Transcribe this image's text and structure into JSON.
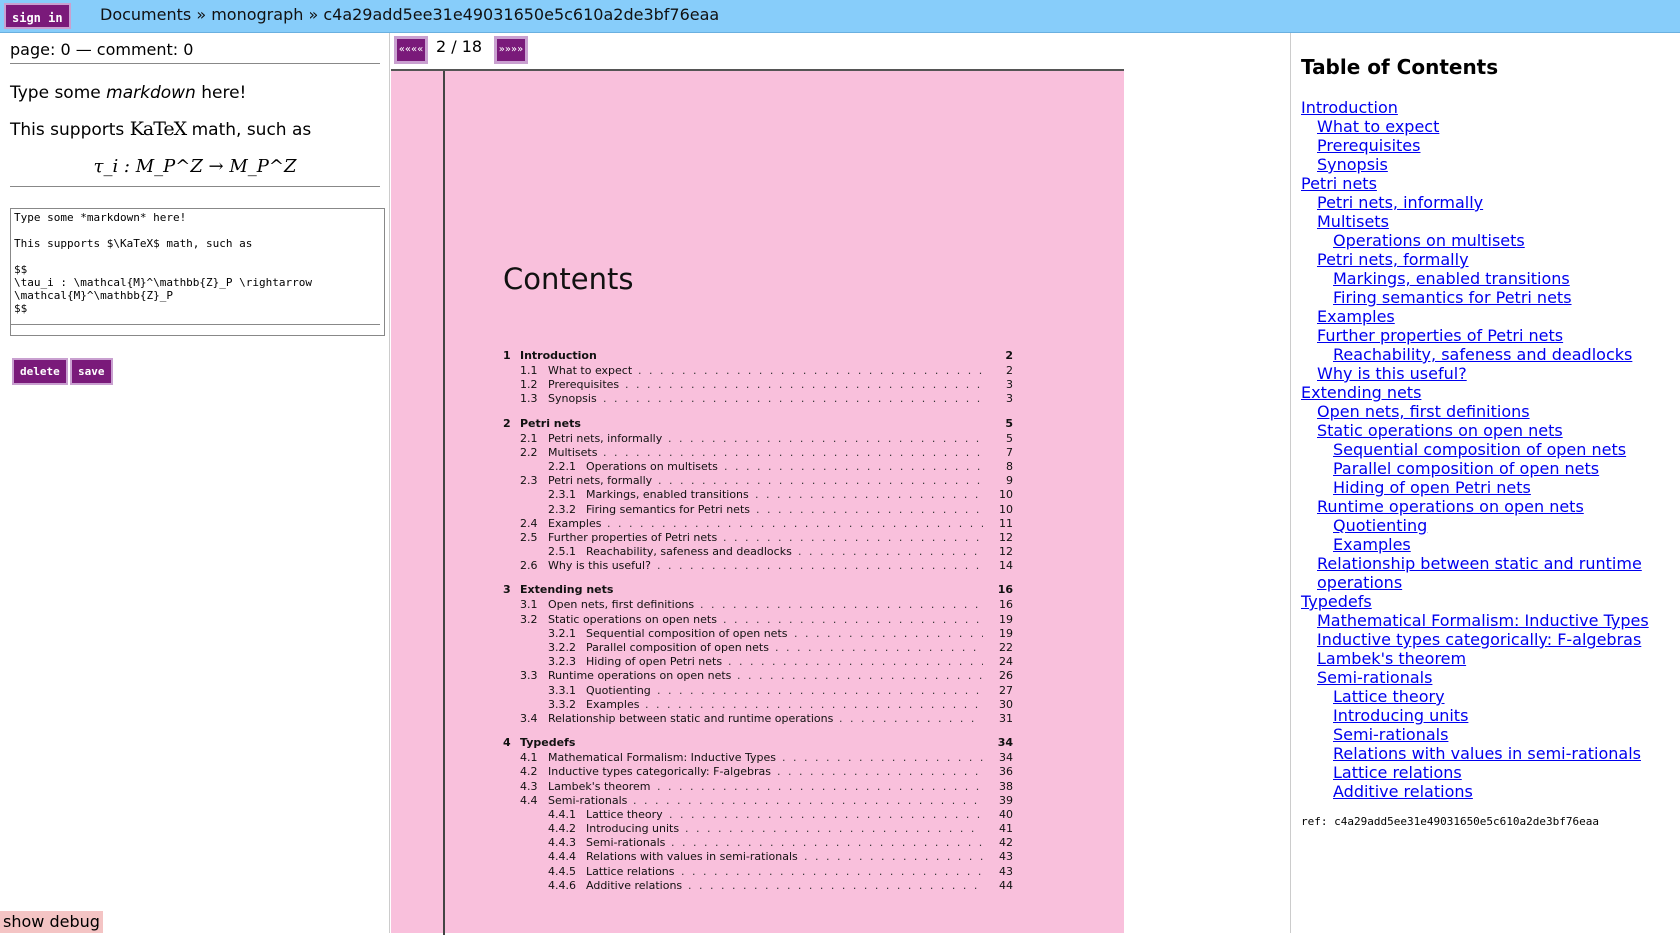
{
  "topbar": {
    "sign_in": "sign in",
    "breadcrumb": [
      "Documents",
      "»",
      "monograph",
      "»",
      "c4a29add5ee31e49031650e5c610a2de3bf76eaa"
    ]
  },
  "left": {
    "status": "page: 0 — comment: 0",
    "preview_line1_a": "Type some ",
    "preview_line1_em": "markdown",
    "preview_line1_b": " here!",
    "preview_line2_a": "This supports ",
    "katex": "KaTeX",
    "preview_line2_b": " math, such as",
    "formula": "τ_i : M_P^Z → M_P^Z",
    "editor_text": "Type some *markdown* here!\n\nThis supports $\\KaTeX$ math, such as\n\n$$\n\\tau_i : \\mathcal{M}^\\mathbb{Z}_P \\rightarrow\n\\mathcal{M}^\\mathbb{Z}_P\n$$",
    "delete_label": "delete",
    "save_label": "save",
    "debug_label": "show debug"
  },
  "viewer": {
    "prev_icon": "««««",
    "next_icon": "»»»»",
    "page_indicator": "2 / 18",
    "heading": "Contents",
    "entries": [
      {
        "n": "1",
        "t": "Introduction",
        "p": "2",
        "lvl": 0
      },
      {
        "n": "1.1",
        "t": "What to expect",
        "p": "2",
        "lvl": 1
      },
      {
        "n": "1.2",
        "t": "Prerequisites",
        "p": "3",
        "lvl": 1
      },
      {
        "n": "1.3",
        "t": "Synopsis",
        "p": "3",
        "lvl": 1
      },
      {
        "n": "2",
        "t": "Petri nets",
        "p": "5",
        "lvl": 0
      },
      {
        "n": "2.1",
        "t": "Petri nets, informally",
        "p": "5",
        "lvl": 1
      },
      {
        "n": "2.2",
        "t": "Multisets",
        "p": "7",
        "lvl": 1
      },
      {
        "n": "2.2.1",
        "t": "Operations on multisets",
        "p": "8",
        "lvl": 2
      },
      {
        "n": "2.3",
        "t": "Petri nets, formally",
        "p": "9",
        "lvl": 1
      },
      {
        "n": "2.3.1",
        "t": "Markings, enabled transitions",
        "p": "10",
        "lvl": 2
      },
      {
        "n": "2.3.2",
        "t": "Firing semantics for Petri nets",
        "p": "10",
        "lvl": 2
      },
      {
        "n": "2.4",
        "t": "Examples",
        "p": "11",
        "lvl": 1
      },
      {
        "n": "2.5",
        "t": "Further properties of Petri nets",
        "p": "12",
        "lvl": 1
      },
      {
        "n": "2.5.1",
        "t": "Reachability, safeness and deadlocks",
        "p": "12",
        "lvl": 2
      },
      {
        "n": "2.6",
        "t": "Why is this useful?",
        "p": "14",
        "lvl": 1
      },
      {
        "n": "3",
        "t": "Extending nets",
        "p": "16",
        "lvl": 0
      },
      {
        "n": "3.1",
        "t": "Open nets, first definitions",
        "p": "16",
        "lvl": 1
      },
      {
        "n": "3.2",
        "t": "Static operations on open nets",
        "p": "19",
        "lvl": 1
      },
      {
        "n": "3.2.1",
        "t": "Sequential composition of open nets",
        "p": "19",
        "lvl": 2
      },
      {
        "n": "3.2.2",
        "t": "Parallel composition of open nets",
        "p": "22",
        "lvl": 2
      },
      {
        "n": "3.2.3",
        "t": "Hiding of open Petri nets",
        "p": "24",
        "lvl": 2
      },
      {
        "n": "3.3",
        "t": "Runtime operations on open nets",
        "p": "26",
        "lvl": 1
      },
      {
        "n": "3.3.1",
        "t": "Quotienting",
        "p": "27",
        "lvl": 2
      },
      {
        "n": "3.3.2",
        "t": "Examples",
        "p": "30",
        "lvl": 2
      },
      {
        "n": "3.4",
        "t": "Relationship between static and runtime operations",
        "p": "31",
        "lvl": 1
      },
      {
        "n": "4",
        "t": "Typedefs",
        "p": "34",
        "lvl": 0
      },
      {
        "n": "4.1",
        "t": "Mathematical Formalism: Inductive Types",
        "p": "34",
        "lvl": 1
      },
      {
        "n": "4.2",
        "t": "Inductive types categorically: F-algebras",
        "p": "36",
        "lvl": 1
      },
      {
        "n": "4.3",
        "t": "Lambek's theorem",
        "p": "38",
        "lvl": 1
      },
      {
        "n": "4.4",
        "t": "Semi-rationals",
        "p": "39",
        "lvl": 1
      },
      {
        "n": "4.4.1",
        "t": "Lattice theory",
        "p": "40",
        "lvl": 2
      },
      {
        "n": "4.4.2",
        "t": "Introducing units",
        "p": "41",
        "lvl": 2
      },
      {
        "n": "4.4.3",
        "t": "Semi-rationals",
        "p": "42",
        "lvl": 2
      },
      {
        "n": "4.4.4",
        "t": "Relations with values in semi-rationals",
        "p": "43",
        "lvl": 2
      },
      {
        "n": "4.4.5",
        "t": "Lattice relations",
        "p": "43",
        "lvl": 2
      },
      {
        "n": "4.4.6",
        "t": "Additive relations",
        "p": "44",
        "lvl": 2
      }
    ]
  },
  "right": {
    "title": "Table of Contents",
    "links": [
      {
        "t": "Introduction",
        "lvl": 1
      },
      {
        "t": "What to expect",
        "lvl": 2
      },
      {
        "t": "Prerequisites",
        "lvl": 2
      },
      {
        "t": "Synopsis",
        "lvl": 2
      },
      {
        "t": "Petri nets",
        "lvl": 1
      },
      {
        "t": "Petri nets, informally",
        "lvl": 2
      },
      {
        "t": "Multisets",
        "lvl": 2
      },
      {
        "t": "Operations on multisets",
        "lvl": 3
      },
      {
        "t": "Petri nets, formally",
        "lvl": 2
      },
      {
        "t": "Markings, enabled transitions",
        "lvl": 3
      },
      {
        "t": "Firing semantics for Petri nets",
        "lvl": 3
      },
      {
        "t": "Examples",
        "lvl": 2
      },
      {
        "t": "Further properties of Petri nets",
        "lvl": 2
      },
      {
        "t": "Reachability, safeness and deadlocks",
        "lvl": 3
      },
      {
        "t": "Why is this useful?",
        "lvl": 2
      },
      {
        "t": "Extending nets",
        "lvl": 1
      },
      {
        "t": "Open nets, first definitions",
        "lvl": 2
      },
      {
        "t": "Static operations on open nets",
        "lvl": 2
      },
      {
        "t": "Sequential composition of open nets",
        "lvl": 3
      },
      {
        "t": "Parallel composition of open nets",
        "lvl": 3
      },
      {
        "t": "Hiding of open Petri nets",
        "lvl": 3
      },
      {
        "t": "Runtime operations on open nets",
        "lvl": 2
      },
      {
        "t": "Quotienting",
        "lvl": 3
      },
      {
        "t": "Examples",
        "lvl": 3
      },
      {
        "t": "Relationship between static and runtime",
        "lvl": 2
      },
      {
        "t": "operations",
        "lvl": 2
      },
      {
        "t": "Typedefs",
        "lvl": 1
      },
      {
        "t": "Mathematical Formalism: Inductive Types",
        "lvl": 2
      },
      {
        "t": "Inductive types categorically: F-algebras",
        "lvl": 2
      },
      {
        "t": "Lambek's theorem",
        "lvl": 2
      },
      {
        "t": "Semi-rationals",
        "lvl": 2
      },
      {
        "t": "Lattice theory",
        "lvl": 3
      },
      {
        "t": "Introducing units",
        "lvl": 3
      },
      {
        "t": "Semi-rationals",
        "lvl": 3
      },
      {
        "t": "Relations with values in semi-rationals",
        "lvl": 3
      },
      {
        "t": "Lattice relations",
        "lvl": 3
      },
      {
        "t": "Additive relations",
        "lvl": 3
      }
    ],
    "ref": "ref: c4a29add5ee31e49031650e5c610a2de3bf76eaa"
  }
}
